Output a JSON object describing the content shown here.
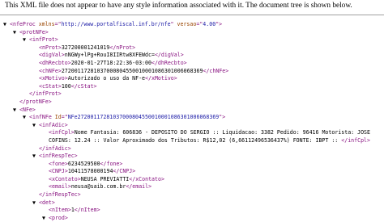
{
  "notice": "This XML file does not appear to have any style information associated with it. The document tree is shown below.",
  "lines": [
    {
      "toggle": "▼",
      "indent": 0,
      "open": "nfeProc",
      "attrs": [
        {
          "name": "xmlns",
          "value": "http://www.portalfiscal.inf.br/nfe"
        },
        {
          "name": "versao",
          "value": "4.00"
        }
      ],
      "close": ""
    },
    {
      "toggle": "▼",
      "indent": 1,
      "open": "protNFe",
      "close": ""
    },
    {
      "toggle": "▼",
      "indent": 2,
      "open": "infProt",
      "close": ""
    },
    {
      "indent": 3,
      "open": "nProt",
      "text": "327200001241019",
      "close": "nProt"
    },
    {
      "indent": 3,
      "open": "digVal",
      "text": "nNGWy+lPg+RouI8IIRtw8XFEWdc=",
      "close": "digVal"
    },
    {
      "indent": 3,
      "open": "dhRecbto",
      "text": "2020-01-27T18:22:36-03:00",
      "close": "dhRecbto"
    },
    {
      "indent": 3,
      "open": "chNFe",
      "text": "27200117281037000804550010001086301006068369",
      "close": "chNFe"
    },
    {
      "indent": 3,
      "open": "xMotivo",
      "text": "Autorizado o uso da NF-e",
      "close": "xMotivo"
    },
    {
      "indent": 3,
      "open": "cStat",
      "text": "100",
      "close": "cStat"
    },
    {
      "indent": 2,
      "open": "",
      "close": "infProt"
    },
    {
      "indent": 1,
      "open": "",
      "close": "protNFe"
    },
    {
      "toggle": "▼",
      "indent": 1,
      "open": "NFe",
      "close": ""
    },
    {
      "toggle": "▼",
      "indent": 2,
      "open": "infNFe",
      "attrs": [
        {
          "name": "Id",
          "value": "NFe27200117281037000804550010001086301006068369"
        }
      ],
      "close": ""
    },
    {
      "toggle": "▼",
      "indent": 3,
      "open": "infAdic",
      "close": ""
    },
    {
      "indent": 4,
      "open": "infCpl",
      "text": "Nome Fantasia: 606836 - DEPOSITO DO SERGIO :: Liquidacao: 3382 Pedido: 96416 Motorista: JOSE",
      "close": ""
    },
    {
      "indent": 4,
      "open": "",
      "text": "COFINS: 12.24 :: Valor Aproximado dos Tributos: R$12,02 (6,66112496536437%) FONTE: IBPT :: ",
      "close": "infCpl"
    },
    {
      "indent": 3,
      "open": "",
      "close": "infAdic"
    },
    {
      "toggle": "▼",
      "indent": 3,
      "open": "infRespTec",
      "close": ""
    },
    {
      "indent": 4,
      "open": "fone",
      "text": "6234529500",
      "close": "fone"
    },
    {
      "indent": 4,
      "open": "CNPJ",
      "text": "10411578000194",
      "close": "CNPJ"
    },
    {
      "indent": 4,
      "open": "xContato",
      "text": "NEUSA PREVIATTI",
      "close": "xContato"
    },
    {
      "indent": 4,
      "open": "email",
      "text": "neusa@saib.com.br",
      "close": "email"
    },
    {
      "indent": 3,
      "open": "",
      "close": "infRespTec"
    },
    {
      "toggle": "▼",
      "indent": 3,
      "open": "det",
      "close": ""
    },
    {
      "indent": 4,
      "open": "nItem",
      "text": "1",
      "close": "nItem"
    },
    {
      "toggle": "▼",
      "indent": 4,
      "open": "prod",
      "close": ""
    }
  ]
}
